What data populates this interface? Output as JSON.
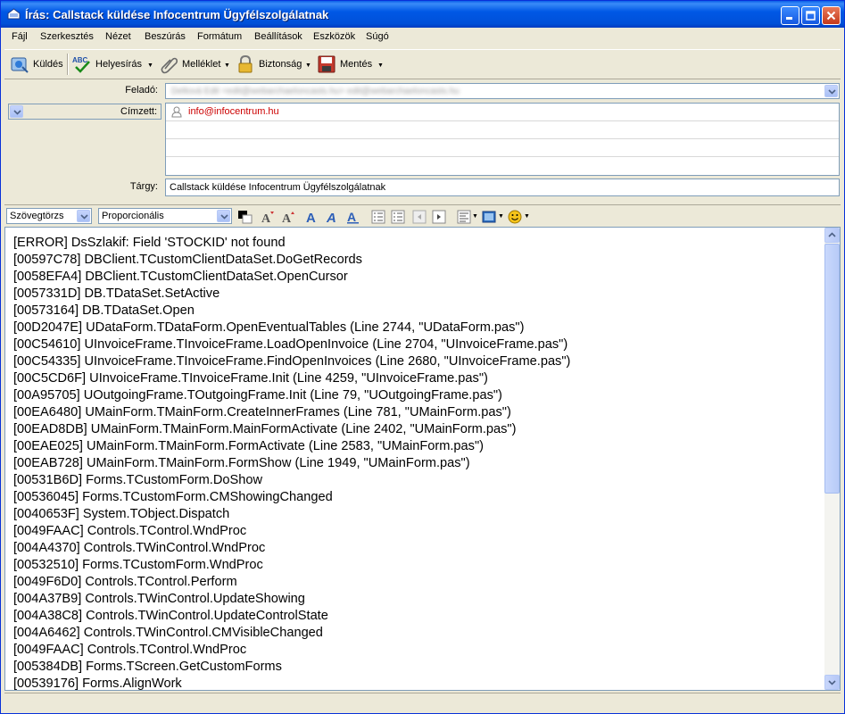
{
  "window": {
    "title": "Írás: Callstack küldése Infocentrum Ügyfélszolgálatnak",
    "controls": [
      "minimize-icon",
      "maximize-icon",
      "close-icon"
    ]
  },
  "menubar": {
    "items": [
      {
        "label": "Fájl"
      },
      {
        "label": "Szerkesztés"
      },
      {
        "label": "Nézet"
      },
      {
        "label": "Beszúrás"
      },
      {
        "label": "Formátum"
      },
      {
        "label": "Beállítások"
      },
      {
        "label": "Eszközök"
      },
      {
        "label": "Súgó"
      }
    ]
  },
  "toolbar": {
    "send_label": "Küldés",
    "spelling_label": "Helyesírás",
    "attach_label": "Melléklet",
    "security_label": "Biztonság",
    "save_label": "Mentés"
  },
  "header": {
    "from_label": "Feladó:",
    "from_value": "Deltová Edit <edit@webarchaeloncasts.hu> edit@webarchaeloncasts.hu",
    "recipient_type": "Címzett:",
    "recipients": [
      "info@infocentrum.hu",
      "",
      "",
      ""
    ],
    "subject_label": "Tárgy:",
    "subject_value": "Callstack küldése Infocentrum Ügyfélszolgálatnak"
  },
  "format_bar": {
    "paragraph_style": "Szövegtörzs",
    "font": "Proporcionális"
  },
  "body": {
    "lines": [
      "[ERROR] DsSzlakif: Field 'STOCKID' not found",
      "[00597C78] DBClient.TCustomClientDataSet.DoGetRecords",
      "[0058EFA4] DBClient.TCustomClientDataSet.OpenCursor",
      "[0057331D] DB.TDataSet.SetActive",
      "[00573164] DB.TDataSet.Open",
      "[00D2047E] UDataForm.TDataForm.OpenEventualTables (Line 2744, \"UDataForm.pas\")",
      "[00C54610] UInvoiceFrame.TInvoiceFrame.LoadOpenInvoice (Line 2704, \"UInvoiceFrame.pas\")",
      "[00C54335] UInvoiceFrame.TInvoiceFrame.FindOpenInvoices (Line 2680, \"UInvoiceFrame.pas\")",
      "[00C5CD6F] UInvoiceFrame.TInvoiceFrame.Init (Line 4259, \"UInvoiceFrame.pas\")",
      "[00A95705] UOutgoingFrame.TOutgoingFrame.Init (Line 79, \"UOutgoingFrame.pas\")",
      "[00EA6480] UMainForm.TMainForm.CreateInnerFrames (Line 781, \"UMainForm.pas\")",
      "[00EAD8DB] UMainForm.TMainForm.MainFormActivate (Line 2402, \"UMainForm.pas\")",
      "[00EAE025] UMainForm.TMainForm.FormActivate (Line 2583, \"UMainForm.pas\")",
      "[00EAB728] UMainForm.TMainForm.FormShow (Line 1949, \"UMainForm.pas\")",
      "[00531B6D] Forms.TCustomForm.DoShow",
      "[00536045] Forms.TCustomForm.CMShowingChanged",
      "[0040653F] System.TObject.Dispatch",
      "[0049FAAC] Controls.TControl.WndProc",
      "[004A4370] Controls.TWinControl.WndProc",
      "[00532510] Forms.TCustomForm.WndProc",
      "[0049F6D0] Controls.TControl.Perform",
      "[004A37B9] Controls.TWinControl.UpdateShowing",
      "[004A38C8] Controls.TWinControl.UpdateControlState",
      "[004A6462] Controls.TWinControl.CMVisibleChanged",
      "[0049FAAC] Controls.TControl.WndProc",
      "[005384DB] Forms.TScreen.GetCustomForms",
      "[00539176] Forms.AlignWork"
    ]
  }
}
